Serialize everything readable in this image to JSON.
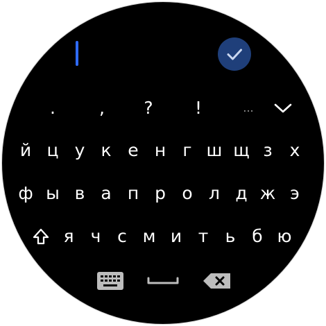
{
  "colors": {
    "background": "#000000",
    "cursor": "#2f6bff",
    "confirm_button": "#1f3f7a",
    "key_text": "#ffffff",
    "icon_gray": "#bdbdbd"
  },
  "icons": {
    "confirm": "checkmark-icon",
    "collapse": "chevron-down-icon",
    "shift": "shift-arrow-icon",
    "keyboard": "keyboard-icon",
    "space": "space-bar-icon",
    "backspace": "backspace-icon"
  },
  "punctuation": [
    ".",
    ",",
    "?",
    "!",
    "..."
  ],
  "rows": [
    [
      "й",
      "ц",
      "у",
      "к",
      "е",
      "н",
      "г",
      "ш",
      "щ",
      "з",
      "х"
    ],
    [
      "ф",
      "ы",
      "в",
      "а",
      "п",
      "р",
      "о",
      "л",
      "д",
      "ж",
      "э"
    ],
    [
      "я",
      "ч",
      "с",
      "м",
      "и",
      "т",
      "ь",
      "б",
      "ю"
    ]
  ]
}
